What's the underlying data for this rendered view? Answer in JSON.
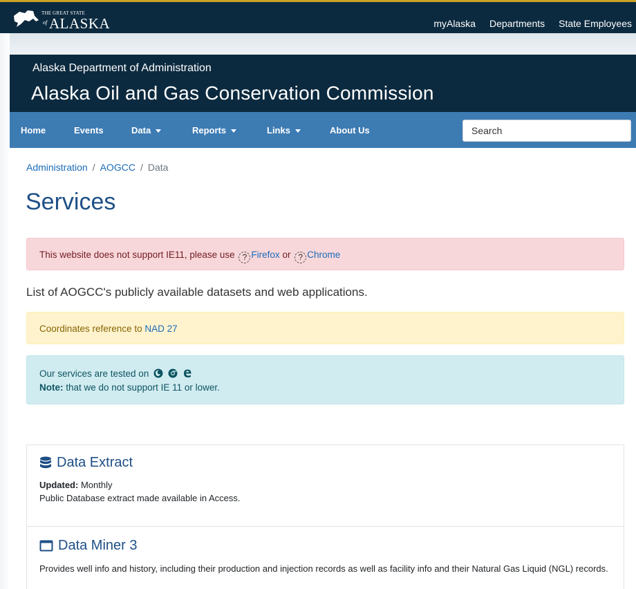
{
  "state_bar": {
    "logo_small": "THE GREAT STATE",
    "logo_of": "of",
    "logo_big": "ALASKA",
    "links": [
      "myAlaska",
      "Departments",
      "State Employees"
    ]
  },
  "banner": {
    "department": "Alaska Department of Administration",
    "commission": "Alaska Oil and Gas Conservation Commission"
  },
  "nav": {
    "items": [
      "Home",
      "Events",
      "Data",
      "Reports",
      "Links",
      "About Us"
    ],
    "search_placeholder": "Search"
  },
  "breadcrumb": {
    "items": [
      "Administration",
      "AOGCC",
      "Data"
    ],
    "separator": "/"
  },
  "page_title": "Services",
  "ie_alert": {
    "text": "This website does not support IE11, please use ",
    "firefox": "Firefox",
    "or": " or ",
    "chrome": "Chrome",
    "icon_glyph": "?"
  },
  "intro": "List of AOGCC's publicly available datasets and web applications.",
  "coords_alert": {
    "text": "Coordinates reference to ",
    "link": "NAD 27"
  },
  "tested_alert": {
    "line1": "Our services are tested on",
    "note_label": "Note:",
    "note_text": " that we do not support IE 11 or lower.",
    "browser_icons": [
      "firefox-icon",
      "chrome-icon",
      "edge-icon"
    ]
  },
  "services": [
    {
      "icon": "database-icon",
      "title": "Data Extract",
      "updated_label": "Updated:",
      "updated_value": " Monthly",
      "description": "Public Database extract made available in Access."
    },
    {
      "icon": "window-icon",
      "title": "Data Miner 3",
      "description": "Provides well info and history, including their production and injection records as well as facility info and their Natural Gas Liquid (NGL) records."
    }
  ],
  "colors": {
    "header_dark": "#0c2a3f",
    "nav_blue": "#3d7bb3",
    "link_blue": "#1a6bb8",
    "title_blue": "#1d4f86",
    "gold_accent": "#c9a227"
  }
}
